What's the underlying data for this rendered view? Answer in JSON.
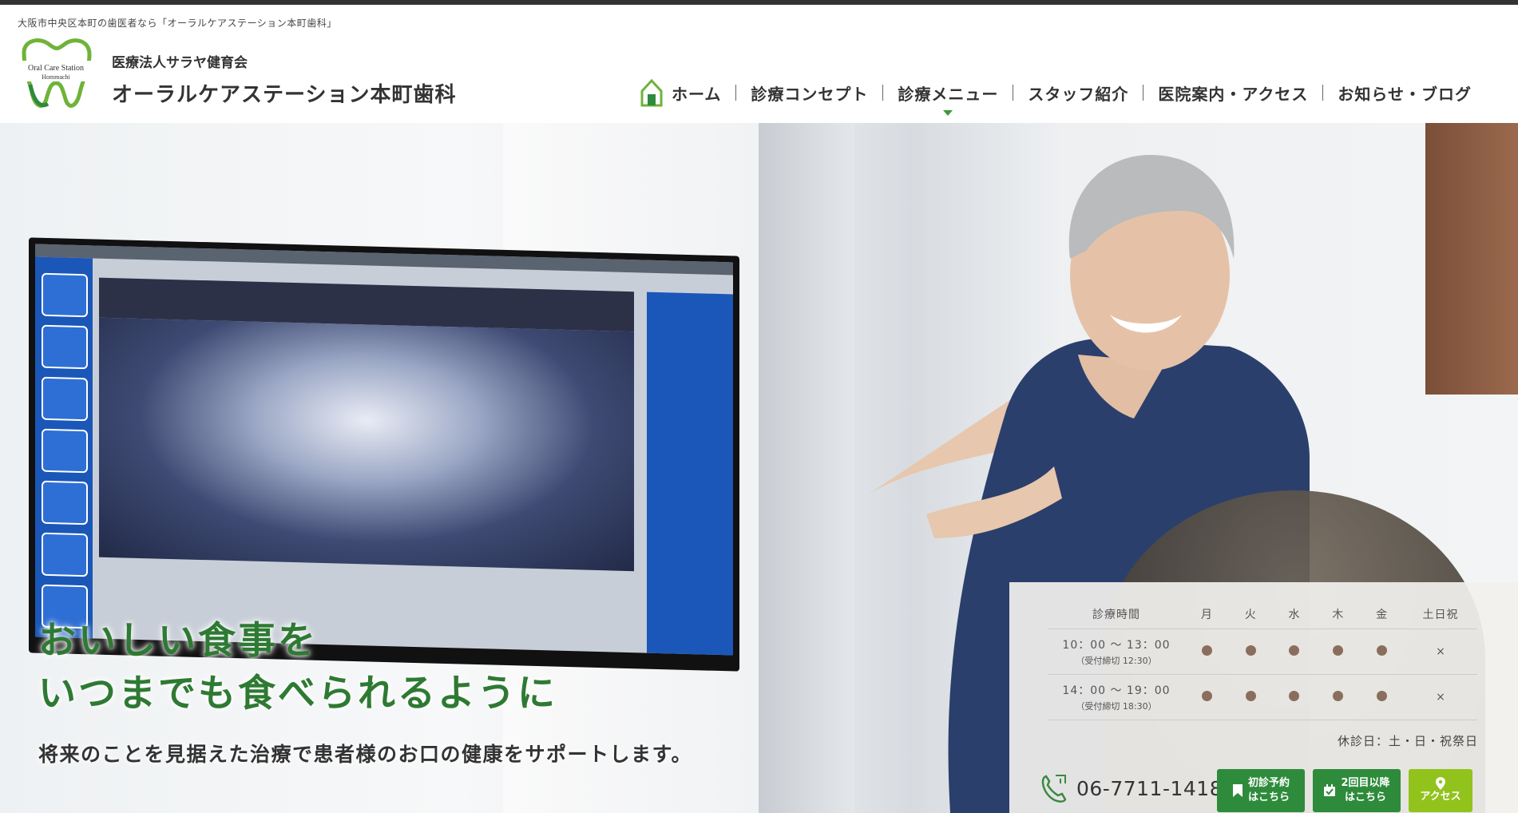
{
  "header": {
    "tagline": "大阪市中央区本町の歯医者なら「オーラルケアステーション本町歯科」",
    "logo_text": [
      "Oral Care Station",
      "Hommachi"
    ],
    "corporation": "医療法人サラヤ健育会",
    "clinic_name": "オーラルケアステーション本町歯科"
  },
  "nav": {
    "items": [
      {
        "label": "ホーム",
        "icon": "home-icon"
      },
      {
        "label": "診療コンセプト"
      },
      {
        "label": "診療メニュー",
        "has_dropdown": true
      },
      {
        "label": "スタッフ紹介"
      },
      {
        "label": "医院案内・アクセス"
      },
      {
        "label": "お知らせ・ブログ"
      }
    ]
  },
  "hero": {
    "headline_line1": "おいしい食事を",
    "headline_line2": "いつまでも食べられるように",
    "subline": "将来のことを見据えた治療で患者様のお口の健康をサポートします。"
  },
  "hours": {
    "headers": [
      "診療時間",
      "月",
      "火",
      "水",
      "木",
      "金",
      "土日祝"
    ],
    "rows": [
      {
        "time": "10：00 〜 13：00",
        "note": "（受付締切 12:30）",
        "days": [
          "open",
          "open",
          "open",
          "open",
          "open",
          "closed"
        ]
      },
      {
        "time": "14：00 〜 19：00",
        "note": "（受付締切 18:30）",
        "days": [
          "open",
          "open",
          "open",
          "open",
          "open",
          "closed"
        ]
      }
    ],
    "closed_mark": "×",
    "closed_days": "休診日：土・日・祝祭日"
  },
  "contact": {
    "phone": "06-7711-1418",
    "first_visit": [
      "初診予約",
      "はこちら"
    ],
    "return_visit": [
      "2回目以降",
      "はこちら"
    ],
    "access": "アクセス"
  },
  "colors": {
    "brand_green": "#2e7a33",
    "button_green": "#2e8b3b",
    "button_lime": "#92c31d",
    "dot_brown": "#8a6e5d"
  }
}
